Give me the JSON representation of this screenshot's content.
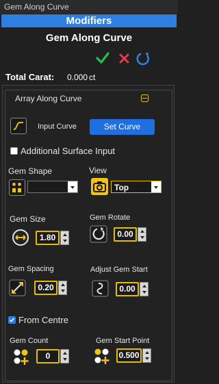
{
  "window": {
    "title": "Gem Along Curve"
  },
  "header": {
    "modifiers_label": "Modifiers",
    "subtitle": "Gem Along Curve"
  },
  "actions": {
    "confirm_icon": "check-icon",
    "cancel_icon": "close-icon",
    "refresh_icon": "refresh-icon"
  },
  "carat": {
    "label": "Total Carat:",
    "value": "0.000",
    "unit": "ct"
  },
  "group": {
    "title": "Array Along Curve",
    "input_curve": {
      "label": "Input Curve",
      "button": "Set Curve"
    },
    "additional_surface": {
      "label": "Additional Surface Input",
      "checked": false
    },
    "gem_shape": {
      "label": "Gem Shape",
      "selected": ""
    },
    "view": {
      "label": "View",
      "selected": "Top"
    },
    "gem_size": {
      "label": "Gem Size",
      "value": "1.80"
    },
    "gem_rotate": {
      "label": "Gem Rotate",
      "value": "0.00"
    },
    "gem_spacing": {
      "label": "Gem Spacing",
      "value": "0.20"
    },
    "adjust_gem_start": {
      "label": "Adjust Gem Start",
      "value": "0.00"
    },
    "from_centre": {
      "label": "From Centre",
      "checked": true
    },
    "gem_count": {
      "label": "Gem Count",
      "value": "0"
    },
    "gem_start_point": {
      "label": "Gem Start Point",
      "value": "0.500"
    }
  },
  "colors": {
    "accent": "#2f7fe3",
    "spinner_border": "#e6c000",
    "ok": "#27c04a",
    "cancel": "#e8394d"
  }
}
